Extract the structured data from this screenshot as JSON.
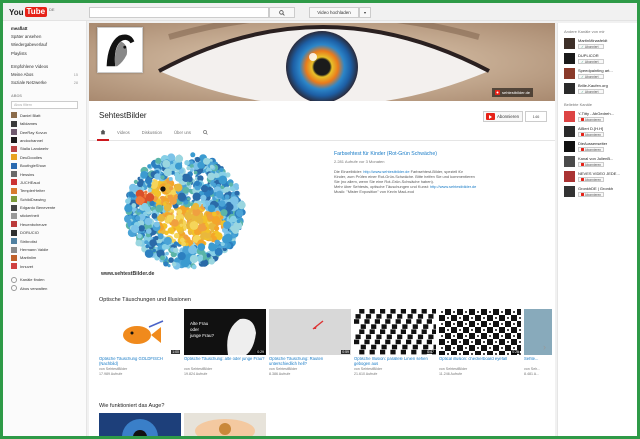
{
  "masthead": {
    "logo_you": "You",
    "logo_tube": "Tube",
    "logo_suffix": "DE",
    "upload_label": "Video hochladen",
    "search_icon": "search-icon"
  },
  "guide": {
    "nav": [
      {
        "label": "meaflatt",
        "active": true
      },
      {
        "label": "Später ansehen"
      },
      {
        "label": "Wiedergabeverlauf"
      },
      {
        "label": "Playlists"
      }
    ],
    "nav2": [
      {
        "label": "Empfohlene Videos",
        "count": ""
      },
      {
        "label": "Meine Abos",
        "count": "15"
      },
      {
        "label": "Soziale Netzwerke",
        "count": "28"
      }
    ],
    "abos_head": "ABOS",
    "search_placeholder": "Abos filtern",
    "subs": [
      {
        "name": "Daniel Blatt",
        "count": "",
        "color": "#8a6b4a"
      },
      {
        "name": "falldames",
        "count": "",
        "color": "#3a3a3a"
      },
      {
        "name": "DeeRay Kovun",
        "count": "",
        "color": "#6f5a6e"
      },
      {
        "name": "andochannel",
        "count": "",
        "color": "#1c1c1c"
      },
      {
        "name": "Stalla Landwehr",
        "count": "",
        "color": "#b44"
      },
      {
        "name": "DeuDoodles",
        "count": "",
        "color": "#e8a21f"
      },
      {
        "name": "BoothgleShow",
        "count": "",
        "color": "#2a6ab0"
      },
      {
        "name": "Hessins",
        "count": "",
        "color": "#6a6a6a"
      },
      {
        "name": "JUCHEaud",
        "count": "",
        "color": "#c33"
      },
      {
        "name": "TemplerHeiter",
        "count": "",
        "color": "#d97a2e"
      },
      {
        "name": "SchildDrawing",
        "count": "",
        "color": "#7b9a3a"
      },
      {
        "name": "Edgardo Benevente",
        "count": "",
        "color": "#444"
      },
      {
        "name": "stickerlneit",
        "count": "",
        "color": "#999"
      },
      {
        "name": "Heuenbcheuve",
        "count": "",
        "color": "#bb3a3a"
      },
      {
        "name": "DORUCIO",
        "count": "",
        "color": "#2f2f2f"
      },
      {
        "name": "Stribrotist",
        "count": "",
        "color": "#5080a0"
      },
      {
        "name": "Hermann Valdie",
        "count": "",
        "color": "#8a8a8a"
      },
      {
        "name": "Martinlim",
        "count": "",
        "color": "#c0602a"
      },
      {
        "name": "Innuvet",
        "count": "",
        "color": "#d04040"
      }
    ],
    "footer": [
      {
        "label": "Kanäle finden"
      },
      {
        "label": "Abos verwalten"
      }
    ]
  },
  "banner": {
    "site_link": "sehtestbilder.de"
  },
  "channel": {
    "title": "SehtestBilder",
    "subscribe_label": "Abonnieren",
    "subscriber_count": "146",
    "tabs": [
      {
        "label": "",
        "icon": "home-icon"
      },
      {
        "label": "Videos"
      },
      {
        "label": "Diskussion"
      },
      {
        "label": "Über uns"
      }
    ]
  },
  "featured": {
    "title": "Farbsehtest für Kinder (Rot-Grün Schwäche)",
    "meta": "2.281 Aufrufe  vor 3 Monaten",
    "desc1_a": "Die Einzelbilder: ",
    "desc1_link": "http://www.sehtestbilder.de",
    "desc1_b": "  Farbsehtest-Bilder, speziell für",
    "desc2": "Kinder, zum Prüfen einer Rot-Grün-Schwäche. Bitte helfen Sie und kommentieren",
    "desc3": "Sie (no allem, wenn Sie eine Rot-Grün-Schwäche haben).",
    "desc4_a": "Mehr über Sehtests, optische Täuschungen und Kunst: ",
    "desc4_link": "http://www.sehtestbilder.de",
    "desc5": "Musik: \"Mister Exposition\" von Kevin MacLeod",
    "watermark": "www.sehtestBilder.de"
  },
  "shelf1": {
    "title": "Optische Täuschungen und Illusionen",
    "videos": [
      {
        "title": "Optische Täuschung GOLDFISCH (Nachbild)",
        "by": "von SehtestBilder",
        "views": "17.989 Aufrufe",
        "duration": "1:00"
      },
      {
        "title": "Optische Täuschung: alte oder junge Frau?",
        "by": "von SehtestBilder",
        "views": "19.824 Aufrufe",
        "duration": "0:29"
      },
      {
        "title": "Optische Täuschung: Rauten unterschiedlich hell?",
        "by": "von SehtestBilder",
        "views": "8.386 Aufrufe",
        "duration": "0:59"
      },
      {
        "title": "Optische Illusion: parallele Linien sehen gebogen aus",
        "by": "von SehtestBilder",
        "views": "21.610 Aufrufe",
        "duration": "0:47"
      },
      {
        "title": "Optical illusion: checkerboard eyefall",
        "by": "von SehtestBilder",
        "views": "11.246 Aufrufe",
        "duration": "0:25"
      },
      {
        "title": "Sehte...",
        "by": "von Seh...",
        "views": "8.481 A...",
        "duration": ""
      }
    ]
  },
  "shelf2": {
    "title": "Wie funktioniert das Auge?"
  },
  "sidebar": {
    "head1": "Andere Kanäle von mir",
    "related": [
      {
        "name": "MartinMinasfeldt",
        "color": "#3d2f28"
      },
      {
        "name": "DUPLICOR",
        "color": "#1a1a1a"
      },
      {
        "name": "Speedpainting art...",
        "color": "#8a3a2a"
      },
      {
        "name": "Brille-Kaufen.org",
        "color": "#2a2a2a"
      }
    ],
    "head2": "Beliebte Kanäle",
    "popular": [
      {
        "name": "Y-Titty - AbGedreh...",
        "color": "#d44"
      },
      {
        "name": "AlBert D.[H.H]",
        "color": "#2a2a2a"
      },
      {
        "name": "DieAussenseiter",
        "color": "#111"
      },
      {
        "name": "Kanal von JulienB...",
        "color": "#4a4a4a"
      },
      {
        "name": "NEVES VIDEO JEDE...",
        "color": "#a33"
      },
      {
        "name": "GronkhDE | Gronkh",
        "color": "#333"
      }
    ],
    "subscribe_label": "Abonniert",
    "subscribe_label2": "Abonnieren"
  }
}
